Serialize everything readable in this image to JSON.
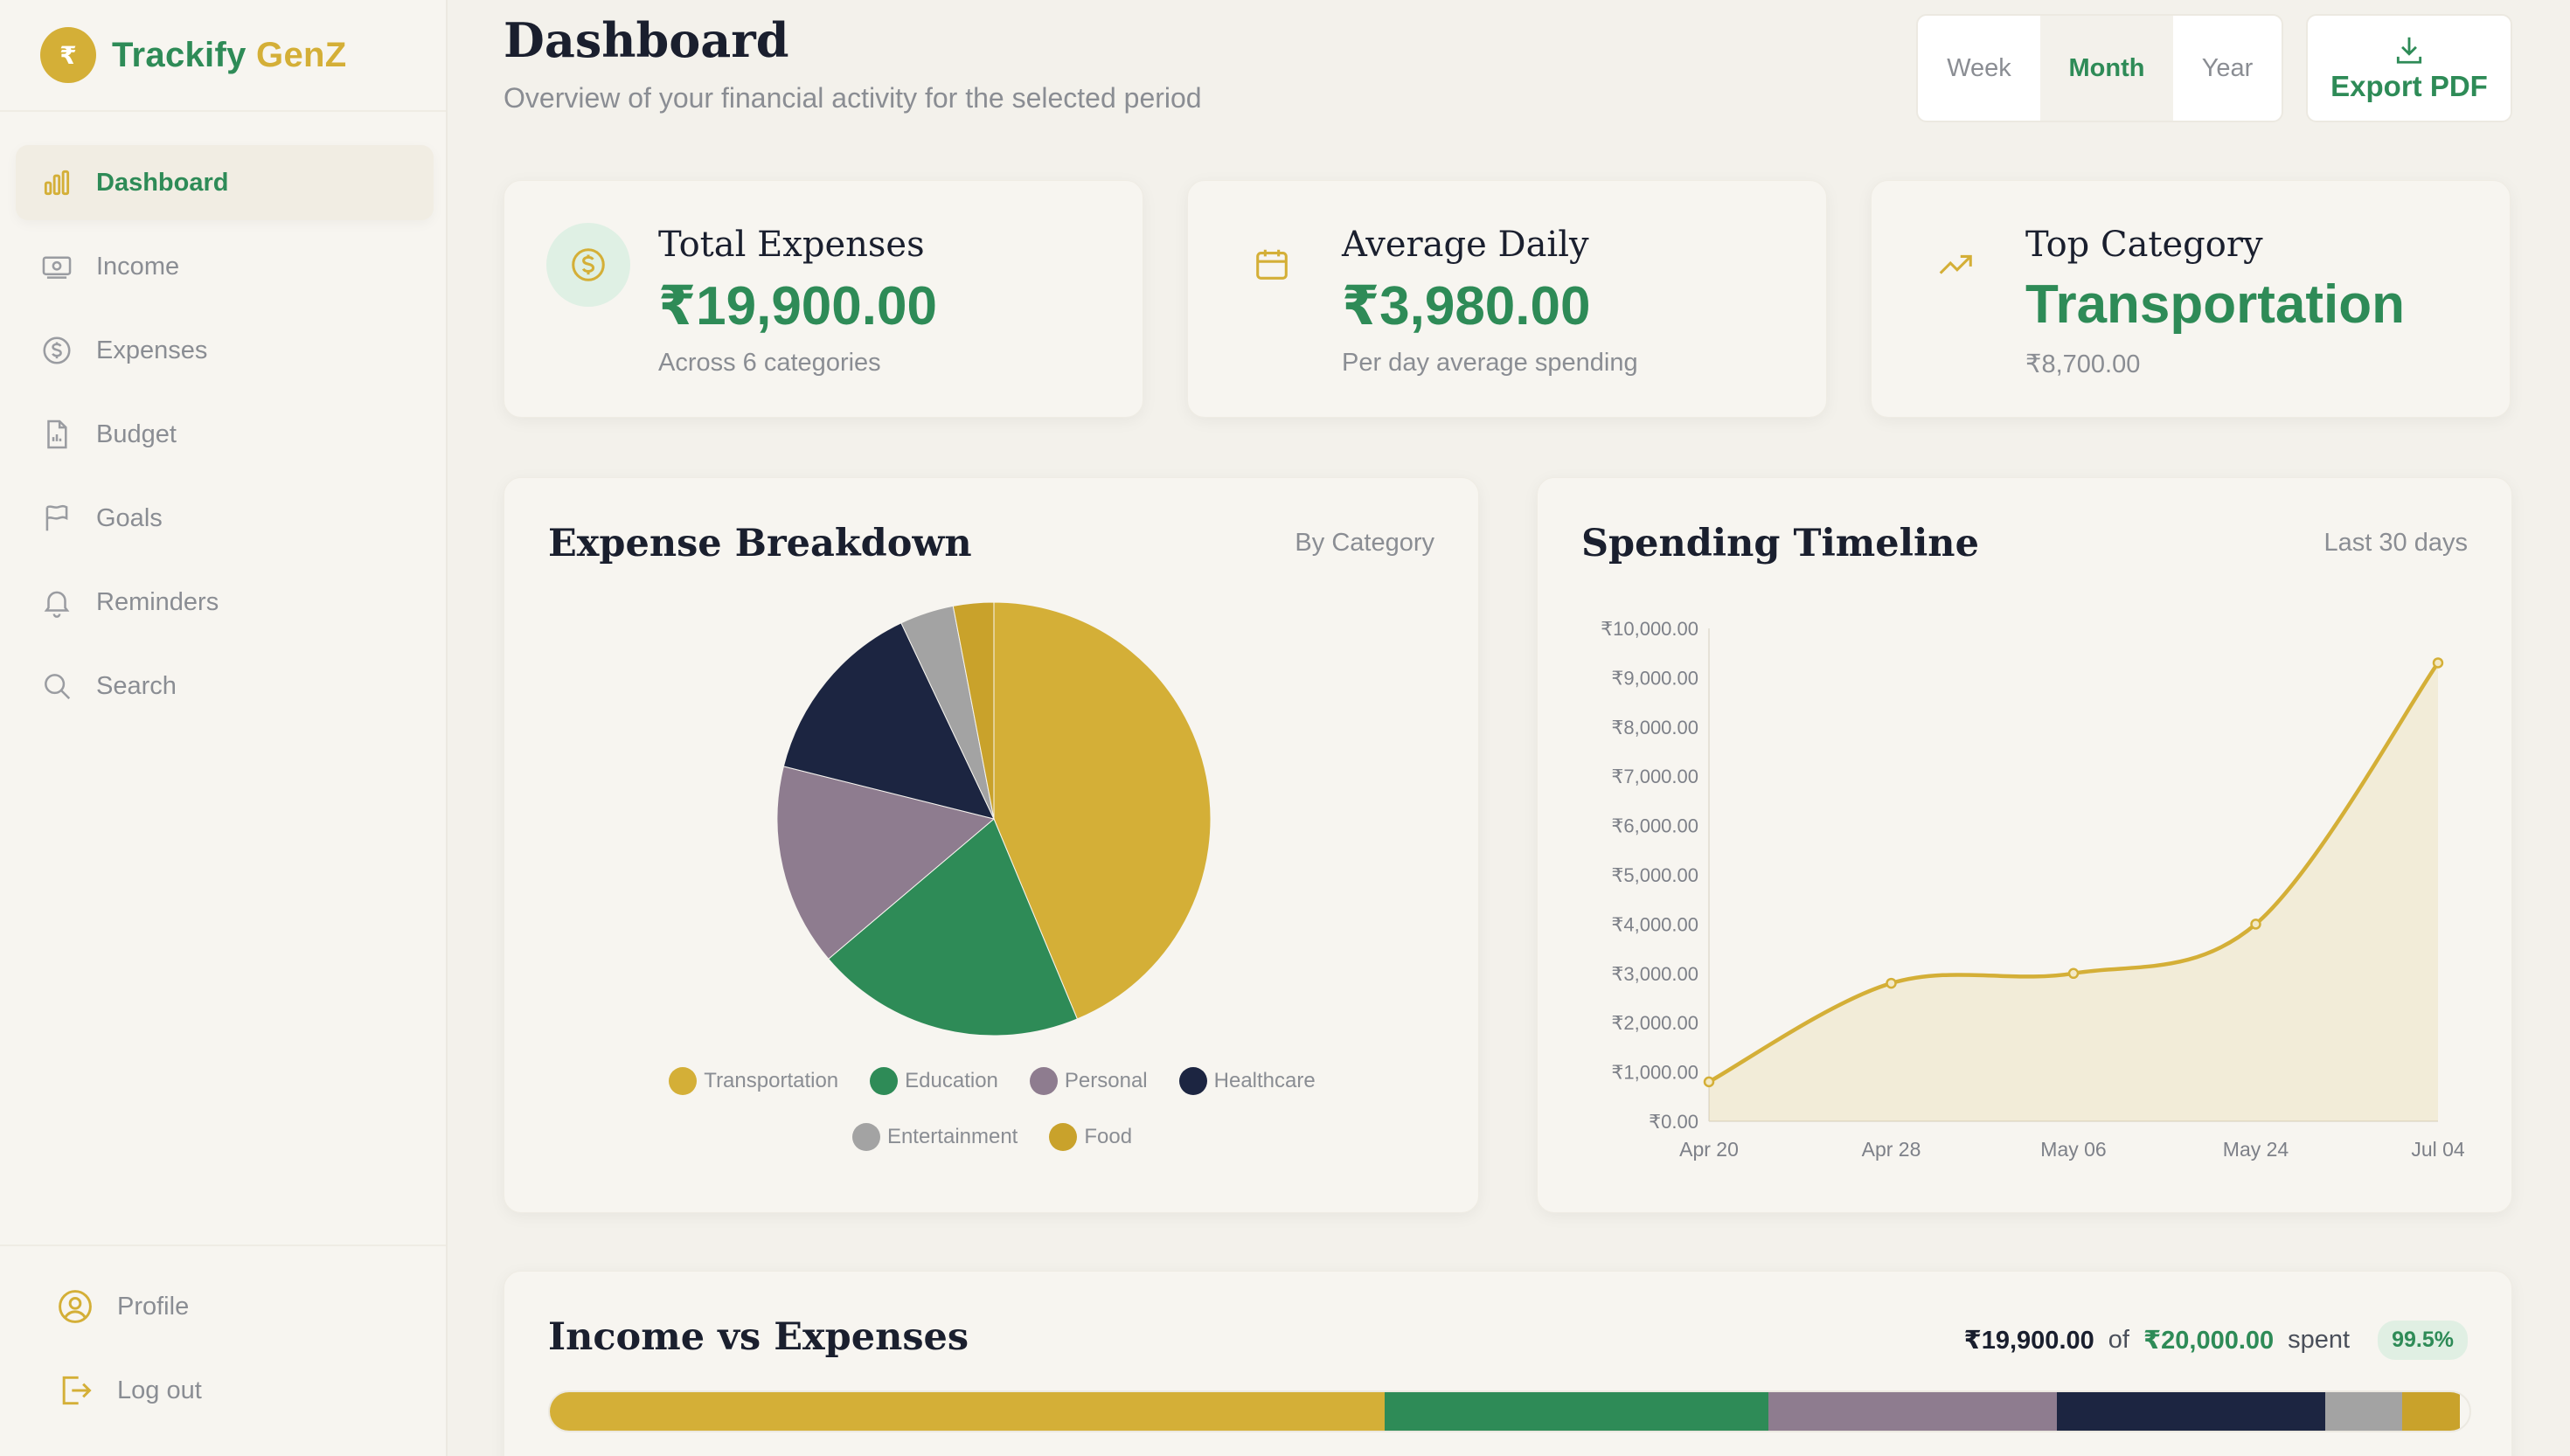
{
  "app": {
    "logo_symbol": "₹",
    "name_part1": "Trackify",
    "name_part2": "GenZ",
    "brand_green": "#2e8b57",
    "brand_gold": "#d4af37"
  },
  "sidebar": {
    "items": [
      {
        "label": "Dashboard",
        "icon": "bar-chart-icon",
        "active": true
      },
      {
        "label": "Income",
        "icon": "banknote-icon"
      },
      {
        "label": "Expenses",
        "icon": "dollar-circle-icon"
      },
      {
        "label": "Budget",
        "icon": "document-chart-icon"
      },
      {
        "label": "Goals",
        "icon": "flag-icon"
      },
      {
        "label": "Reminders",
        "icon": "bell-icon"
      },
      {
        "label": "Search",
        "icon": "search-icon"
      }
    ],
    "bottom": [
      {
        "label": "Profile",
        "icon": "user-circle-icon"
      },
      {
        "label": "Log out",
        "icon": "logout-icon"
      }
    ]
  },
  "header": {
    "title": "Dashboard",
    "subtitle": "Overview of your financial activity for the selected period",
    "periods": [
      "Week",
      "Month",
      "Year"
    ],
    "selected_period": "Month",
    "export_label": "Export PDF"
  },
  "stats": [
    {
      "label": "Total Expenses",
      "value": "₹19,900.00",
      "sub": "Across 6 categories",
      "icon": "dollar-circle-icon"
    },
    {
      "label": "Average Daily",
      "value": "₹3,980.00",
      "sub": "Per day average spending",
      "icon": "calendar-icon"
    },
    {
      "label": "Top Category",
      "value": "Transportation",
      "sub": "₹8,700.00",
      "icon": "trending-up-icon"
    }
  ],
  "breakdown": {
    "title": "Expense Breakdown",
    "tag": "By Category"
  },
  "timeline": {
    "title": "Spending Timeline",
    "tag": "Last 30 days"
  },
  "income_vs_expenses": {
    "title": "Income vs Expenses",
    "spent": "₹19,900.00",
    "of_text": "of",
    "total": "₹20,000.00",
    "spent_text": "spent",
    "percent": "99.5%",
    "percent_value": 99.5
  },
  "chart_data": [
    {
      "type": "pie",
      "categories": [
        "Transportation",
        "Education",
        "Personal",
        "Healthcare",
        "Entertainment",
        "Food"
      ],
      "values": [
        8700,
        4000,
        3000,
        2800,
        800,
        600
      ],
      "colors": [
        "#d4af37",
        "#2e8b57",
        "#8e7c8f",
        "#1c2541",
        "#a3a3a3",
        "#c9a22b"
      ],
      "legend_placement": "bottom"
    },
    {
      "type": "area",
      "x": [
        "Apr 20",
        "Apr 28",
        "May 06",
        "May 24",
        "Jul 04"
      ],
      "values": [
        800,
        2800,
        3000,
        4000,
        9300
      ],
      "ylim": [
        0,
        10000
      ],
      "yticks": [
        "₹0.00",
        "₹1,000.00",
        "₹2,000.00",
        "₹3,000.00",
        "₹4,000.00",
        "₹5,000.00",
        "₹6,000.00",
        "₹7,000.00",
        "₹8,000.00",
        "₹9,000.00",
        "₹10,000.00"
      ],
      "color": "#d4af37",
      "grid": false
    },
    {
      "type": "bar",
      "categories": [
        "Transportation",
        "Education",
        "Personal",
        "Healthcare",
        "Entertainment",
        "Food"
      ],
      "values": [
        8700,
        4000,
        3000,
        2800,
        800,
        600
      ],
      "total": 20000
    }
  ]
}
